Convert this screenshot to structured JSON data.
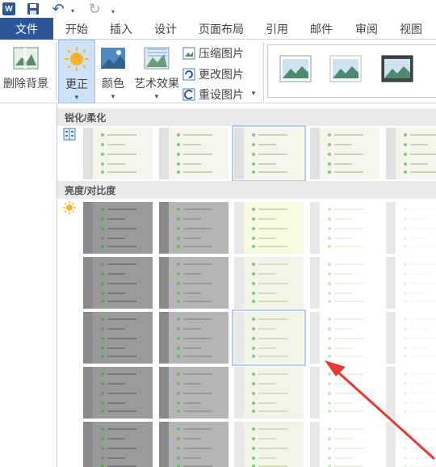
{
  "quick_access": {
    "word_icon_text": "W",
    "icons": [
      "word-icon",
      "save-icon",
      "undo-icon",
      "redo-icon"
    ]
  },
  "tabs": {
    "file": "文件",
    "items": [
      "开始",
      "插入",
      "设计",
      "页面布局",
      "引用",
      "邮件",
      "审阅",
      "视图"
    ]
  },
  "ribbon": {
    "remove_background": "删除背景",
    "corrections": "更正",
    "color": "颜色",
    "artistic_effects": "艺术效果",
    "compress_pictures": "压缩图片",
    "change_picture": "更改图片",
    "reset_picture": "重设图片"
  },
  "gallery": {
    "sharpen_soften": "锐化/柔化",
    "brightness_contrast": "亮度/对比度"
  },
  "colors": {
    "accent": "#2b579a",
    "selection": "#cde2f7",
    "section_header": "#eaeaea",
    "arrow": "#e53935"
  }
}
